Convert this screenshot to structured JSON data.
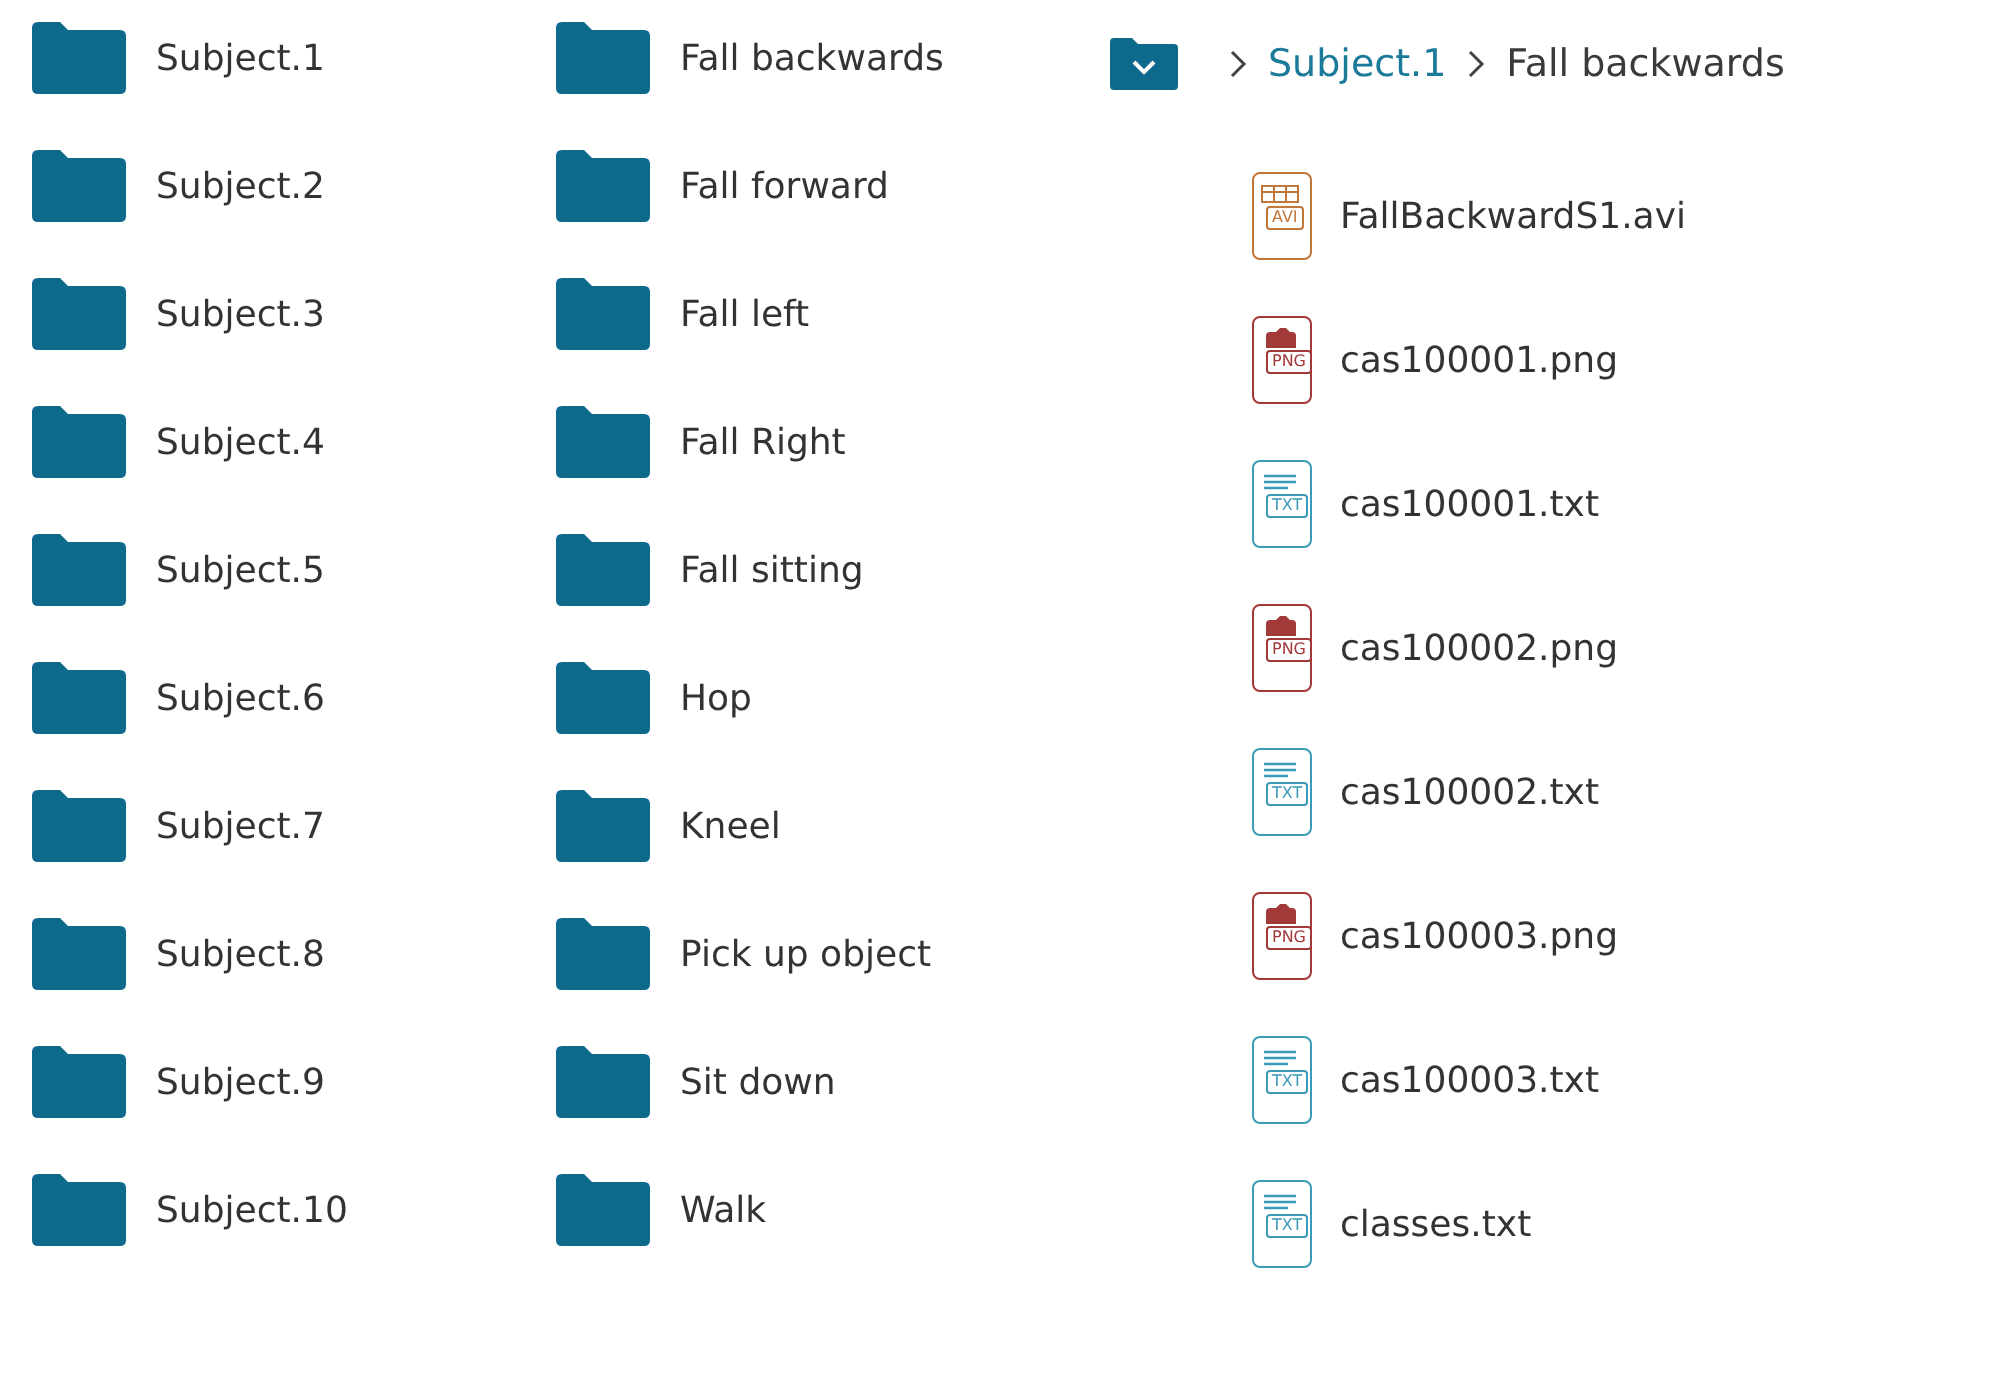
{
  "subject_folders": [
    "Subject.1",
    "Subject.2",
    "Subject.3",
    "Subject.4",
    "Subject.5",
    "Subject.6",
    "Subject.7",
    "Subject.8",
    "Subject.9",
    "Subject.10"
  ],
  "activity_folders": [
    "Fall backwards",
    "Fall forward",
    "Fall left",
    "Fall Right",
    "Fall sitting",
    "Hop",
    "Kneel",
    "Pick up object",
    "Sit down",
    "Walk"
  ],
  "breadcrumb": [
    {
      "label": "Subject.1",
      "kind": "link"
    },
    {
      "label": "Fall backwards",
      "kind": "current"
    }
  ],
  "files": [
    {
      "name": "FallBackwardS1.avi",
      "kind": "video",
      "badge": "AVI"
    },
    {
      "name": "cas100001.png",
      "kind": "image",
      "badge": "PNG"
    },
    {
      "name": "cas100001.txt",
      "kind": "text",
      "badge": "TXT"
    },
    {
      "name": "cas100002.png",
      "kind": "image",
      "badge": "PNG"
    },
    {
      "name": "cas100002.txt",
      "kind": "text",
      "badge": "TXT"
    },
    {
      "name": "cas100003.png",
      "kind": "image",
      "badge": "PNG"
    },
    {
      "name": "cas100003.txt",
      "kind": "text",
      "badge": "TXT"
    },
    {
      "name": "classes.txt",
      "kind": "text",
      "badge": "TXT"
    }
  ]
}
